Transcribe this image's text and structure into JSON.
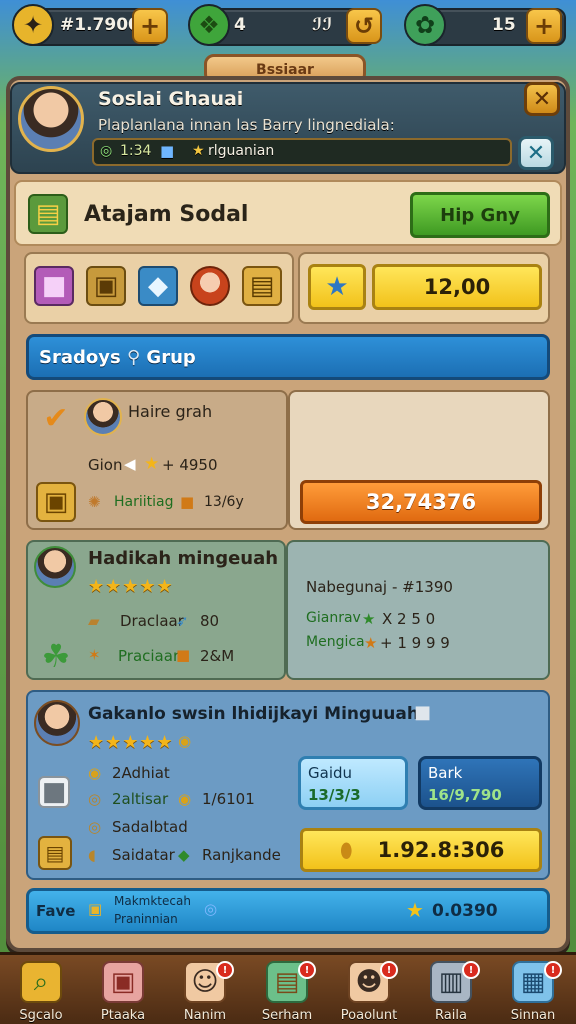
{
  "resources": [
    {
      "icon": "wing-icon",
      "glyph": "✦",
      "value": "#1.7900",
      "color": "#e7b42b"
    },
    {
      "icon": "green-gem-icon",
      "glyph": "❖",
      "value": "4",
      "value2": "ℐℐ",
      "color": "#3fa53b"
    },
    {
      "icon": "green-swirl-icon",
      "glyph": "✿",
      "value": "15",
      "color": "#3fa05a"
    }
  ],
  "peek_tab": "Bssiaar",
  "header": {
    "name": "Soslai Ghauai",
    "subtitle": "Plaplanlana innan las Barry lingnediala:",
    "stat1": "1:34",
    "stat2": "rlguanian"
  },
  "section_title": {
    "label": "Atajam Sodal",
    "button": "Hip Gny"
  },
  "items_row": {
    "icons": [
      "gift-box-icon",
      "crate-icon",
      "blue-gem-icon",
      "girl-avatar-icon",
      "gold-chest-icon"
    ],
    "price": "12,00"
  },
  "group_bar": {
    "label": "Sradoys",
    "label2": "Grup"
  },
  "card1": {
    "title": "Haire grah",
    "line1_a": "Gion",
    "line1_b": "+ 4950",
    "line2_a": "Hariitiag",
    "line2_b": "13/6y",
    "button": "32,74376"
  },
  "card2": {
    "title": "Hadikah mingeuah",
    "stars": "★★★★★",
    "item1": "Draclaar",
    "item1_val": "80",
    "item2": "Praciaar",
    "item2_val": "2&M",
    "stat1_label": "Nabegunaj",
    "stat1_val": "- #1390",
    "stat2_label": "Gianrav",
    "stat2_val": "X 2 5 0",
    "stat3_label": "Mengica",
    "stat3_val": "+ 1 9 9 9"
  },
  "card3": {
    "title": "Gakanlo swsin lhidijkayi Minguuah:",
    "stars": "★★★★★",
    "line1": "2Adhiat",
    "line2_a": "2altisar",
    "line2_b": "1/6101",
    "line3": "Sadalbtad",
    "line4_a": "Saidatar",
    "line4_b": "Ranjkande",
    "tile1_label": "Gaidu",
    "tile1_val": "13/3/3",
    "tile2_label": "Bark",
    "tile2_val": "16/9,790",
    "button": "1.92.8:306"
  },
  "footer_bar": {
    "label": "Fave",
    "text1": "Makmktecah",
    "text2": "Praninnian",
    "amount": "0.0390"
  },
  "nav": [
    {
      "label": "Sgcalo",
      "icon": "magnifier-icon",
      "glyph": "⌕",
      "badge": ""
    },
    {
      "label": "Ptaaka",
      "icon": "dice-box-icon",
      "glyph": "▣",
      "badge": ""
    },
    {
      "label": "Nanim",
      "icon": "avatar-icon",
      "glyph": "☺",
      "badge": "!"
    },
    {
      "label": "Serham",
      "icon": "chest-icon",
      "glyph": "▤",
      "badge": "!"
    },
    {
      "label": "Poaolunt",
      "icon": "friend-icon",
      "glyph": "☻",
      "badge": "!"
    },
    {
      "label": "Raila",
      "icon": "phone-icon",
      "glyph": "▥",
      "badge": "!"
    },
    {
      "label": "Sinnan",
      "icon": "map-icon",
      "glyph": "▦",
      "badge": "!"
    }
  ]
}
